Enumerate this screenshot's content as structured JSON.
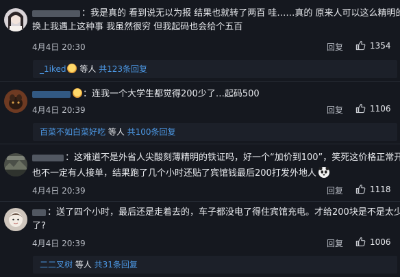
{
  "comments": [
    {
      "line1": "：我是真的 看到说无以为报 结果也就转了两百 哇……真的 原来人可以这么精明的嘛",
      "line2": "换上我遇上这种事 我虽然很穷 但我起码也会给个五百",
      "date": "4月4日 20:30",
      "reply_label": "回复",
      "likes": "1354",
      "sub": {
        "user": "_1iked",
        "mid": " 等人 ",
        "link": "共123条回复"
      }
    },
    {
      "line1": "：连我一个大学生都觉得200少了…起码500",
      "date": "4月4日 20:39",
      "reply_label": "回复",
      "likes": "1106",
      "sub": {
        "user": "百菜不如白菜好吃",
        "mid": " 等人 ",
        "link": "共100条回复"
      }
    },
    {
      "line1": "：这难道不是外省人尖酸刻薄精明的铁证吗，好一个“加价到100”，笑死这价格正常开工",
      "line2": "也不一定有人接单，结果跑了几个小时还贴了宾馆钱最后200打发外地人",
      "date": "4月4日 20:39",
      "reply_label": "回复",
      "likes": "1118"
    },
    {
      "line1": "：送了四个小时，最后还是走着去的，车子都没电了得住宾馆充电。才给200块是不是太少",
      "line2": "了?",
      "date": "4月4日 20:39",
      "reply_label": "回复",
      "likes": "1006",
      "sub": {
        "user": "二二叉树",
        "mid": " 等人 ",
        "link": "共31条回复"
      }
    }
  ],
  "colors": {
    "background": "#15181f",
    "sub_background": "#1c2029",
    "link": "#4d9ae8",
    "text": "#e8eaee",
    "muted": "#b8bcc4"
  },
  "icons": {
    "like": "thumbs-up-icon",
    "emoji": "face-emoji-icon",
    "sticker": "panda-sticker-icon"
  }
}
